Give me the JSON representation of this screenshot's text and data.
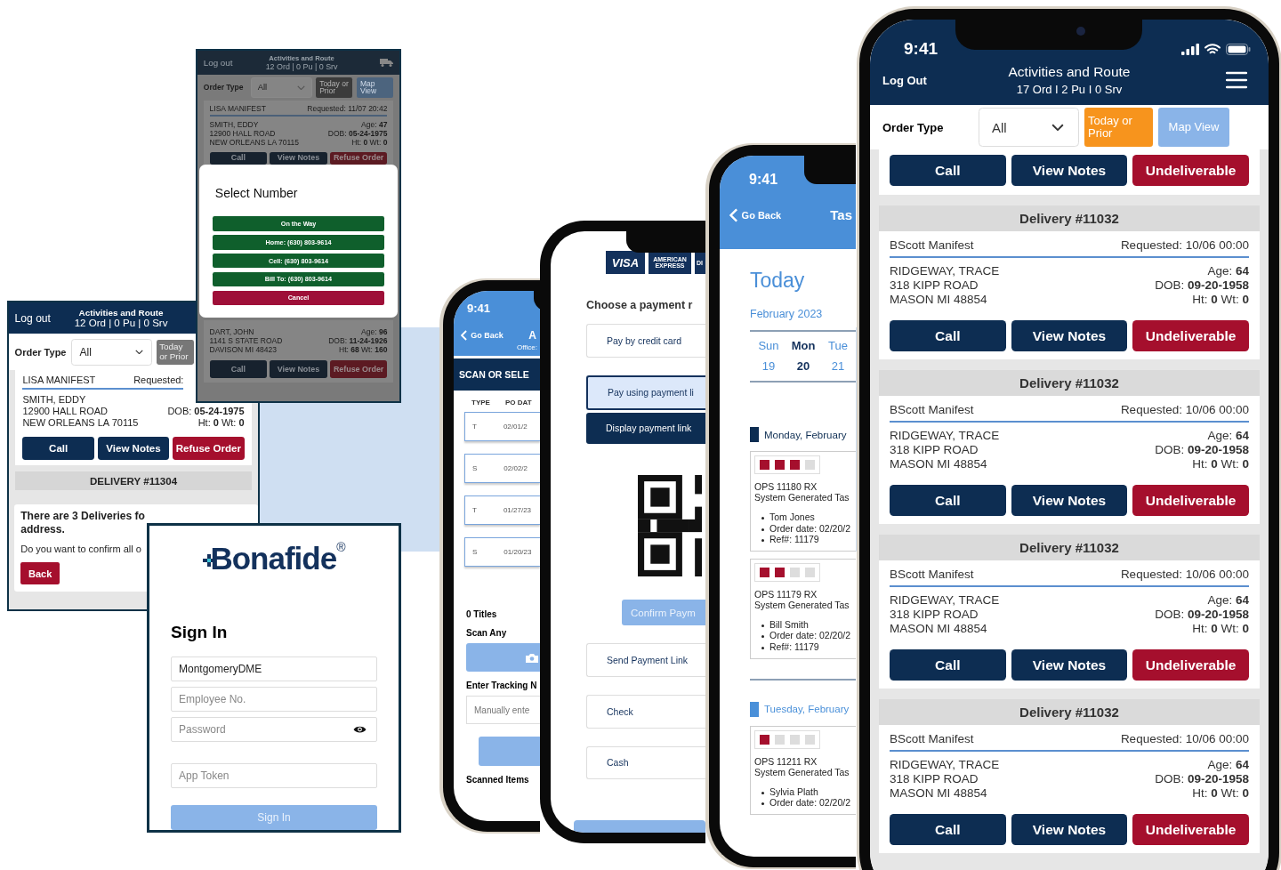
{
  "manifest_screen": {
    "logout": "Log out",
    "title": "Activities and Route",
    "counts": "12 Ord | 0 Pu | 0 Srv",
    "order_type_label": "Order Type",
    "order_type_value": "All",
    "filters": [
      {
        "label": "Today or Prior",
        "selected": false,
        "disabled": false
      },
      {
        "label": "Map View",
        "disabled": true
      }
    ],
    "items": [
      {
        "kind": "order",
        "manifest": "LISA MANIFEST",
        "requested": "Requested: 11/07 20:42",
        "name": "SMITH, EDDY",
        "address": "12900 HALL ROAD",
        "city": "NEW ORLEANS LA 70115",
        "age": "Age: **47**",
        "dob": "DOB: **05-24-1975**",
        "size": "Ht: **0** Wt: **0**",
        "buttons": [
          {
            "label": "Call",
            "kind": "call"
          },
          {
            "label": "View Notes",
            "kind": "notes"
          },
          {
            "label": "Refuse Order",
            "kind": "reject"
          }
        ]
      },
      {
        "kind": "select_dialog",
        "title": "Select Number",
        "options": [
          {
            "label": "On the Way",
            "kind": "option"
          },
          {
            "label": "Home: (630) 803-9614",
            "kind": "option"
          },
          {
            "label": "Cell: (630) 803-9614",
            "kind": "option"
          },
          {
            "label": "Bill To: (630) 803-9614",
            "kind": "option"
          },
          {
            "label": "Cancel",
            "kind": "cancel"
          }
        ]
      },
      {
        "kind": "order",
        "name": "DART, JOHN",
        "address": "1141 S STATE ROAD",
        "city": "DAVISON MI 48423",
        "age": "Age: **96**",
        "dob": "DOB: **11-24-1926**",
        "size": "Ht: **68** Wt: **160**",
        "buttons": [
          {
            "label": "Call",
            "kind": "call"
          },
          {
            "label": "View Notes",
            "kind": "notes"
          },
          {
            "label": "Refuse Order",
            "kind": "reject"
          }
        ]
      }
    ]
  },
  "confirm_screen": {
    "logout": "Log out",
    "title": "Activities and Route",
    "counts": "12 Ord | 0 Pu | 0 Srv",
    "order_type_label": "Order Type",
    "order_type_value": "All",
    "filters": [
      {
        "label": "Today or Prior",
        "selected": false,
        "disabled": false
      }
    ],
    "items": [
      {
        "kind": "order",
        "manifest": "LISA MANIFEST",
        "requested": "Requested:",
        "name": "SMITH, EDDY",
        "address": "12900 HALL ROAD",
        "city": "NEW ORLEANS LA 70115",
        "dob": "DOB: **05-24-1975**",
        "size": "Ht: **0** Wt: **0**",
        "buttons": [
          {
            "label": "Call",
            "kind": "call"
          },
          {
            "label": "View Notes",
            "kind": "notes"
          },
          {
            "label": "Refuse Order",
            "kind": "reject"
          }
        ]
      },
      {
        "kind": "header",
        "label": "DELIVERY #11304"
      },
      {
        "kind": "confirm_dialog",
        "title": "There are 3 Deliveries fo\naddress.",
        "message": "Do you want to confirm all o",
        "button": "Back"
      }
    ]
  },
  "sign_in": {
    "logo": "Bonafide$^{®}$",
    "heading": "Sign In",
    "fields": [
      {
        "kind": "text",
        "value": "MontgomeryDME"
      },
      {
        "kind": "text",
        "placeholder": "Employee No."
      },
      {
        "kind": "password",
        "placeholder": "Password"
      },
      {
        "kind": "text",
        "placeholder": "App Token"
      }
    ],
    "button": {
      "label": "Sign In",
      "disabled": true
    }
  },
  "scan_phone": {
    "time": "9:41",
    "back": "Go Back",
    "title": "A",
    "office": "Office:",
    "banner": "SCAN OR SELE",
    "columns": [
      "TYPE",
      "PO DAT"
    ],
    "rows": [
      {
        "type": "T",
        "po_date": "02/01/2"
      },
      {
        "type": "S",
        "po_date": "02/02/2"
      },
      {
        "type": "T",
        "po_date": "01/27/23"
      },
      {
        "type": "S",
        "po_date": "01/20/23"
      }
    ],
    "titles_count": "0 Titles",
    "scan_label": "Scan Any",
    "tracking_label": "Enter Tracking N",
    "tracking_placeholder": "Manually ente",
    "scanned_label": "Scanned Items"
  },
  "payment_phone": {
    "card_logos": [
      "VISA",
      "AMERICAN EXPRESS",
      "DI"
    ],
    "heading": "Choose a payment r",
    "options": [
      {
        "kind": "option",
        "label": "Pay by credit card",
        "selected": false
      },
      {
        "kind": "option",
        "label": "Pay using payment li",
        "selected": true
      },
      {
        "kind": "action",
        "label": "Display payment link"
      },
      {
        "kind": "qr"
      },
      {
        "kind": "confirm",
        "label": "Confirm Paym",
        "disabled": true
      },
      {
        "kind": "option",
        "label": "Send Payment Link",
        "selected": false
      },
      {
        "kind": "option",
        "label": "Check",
        "selected": false
      },
      {
        "kind": "option",
        "label": "Cash",
        "selected": false
      }
    ]
  },
  "tasks_phone": {
    "time": "9:41",
    "back": "Go Back",
    "title": "Tas",
    "heading": "Today",
    "month": "February 2023",
    "days": [
      {
        "name": "Sun",
        "date": "19",
        "selected": false
      },
      {
        "name": "Mon",
        "date": "20",
        "selected": true
      },
      {
        "name": "Tue",
        "date": "21",
        "selected": false
      }
    ],
    "groups": [
      {
        "label": "Monday, February",
        "color": "#0d2d52",
        "tasks": [
          {
            "stars": 3,
            "code": "OPS 11180 RX",
            "subtitle": "System Generated Tas",
            "details": [
              "Tom Jones",
              "Order date: 02/20/2",
              "Ref#: 11179"
            ]
          },
          {
            "stars": 2,
            "code": "OPS 11179 RX",
            "subtitle": "System Generated Tas",
            "details": [
              "Bill Smith",
              "Order date: 02/20/2",
              "Ref#: 11179"
            ]
          }
        ]
      },
      {
        "label": "Tuesday, February",
        "color": "#4a90d9",
        "tasks": [
          {
            "stars": 1,
            "code": "OPS 11211 RX",
            "subtitle": "System Generated Tas",
            "details": [
              "Sylvia Plath",
              "Order date: 02/20/2"
            ]
          }
        ]
      }
    ]
  },
  "route_phone": {
    "time": "9:41",
    "logout": "Log Out",
    "title": "Activities and Route",
    "counts": "17 Ord I 2 Pu I 0 Srv",
    "order_type_label": "Order Type",
    "order_type_value": "All",
    "filters": [
      {
        "label": "Today or Prior",
        "selected": true,
        "disabled": false
      },
      {
        "label": "Map View",
        "disabled": true
      }
    ],
    "items": [
      {
        "kind": "actions",
        "buttons": [
          {
            "label": "Call",
            "kind": "call"
          },
          {
            "label": "View Notes",
            "kind": "notes"
          },
          {
            "label": "Undeliverable",
            "kind": "reject"
          }
        ]
      },
      {
        "kind": "header",
        "label": "Delivery #11032"
      },
      {
        "kind": "order",
        "manifest": "BScott Manifest",
        "requested": "Requested: 10/06  00:00",
        "name": "RIDGEWAY, TRACE",
        "address": "318 KIPP ROAD",
        "city": "MASON MI 48854",
        "age": "Age: **64**",
        "dob": "DOB: **09-20-1958**",
        "size": "Ht: **0**  Wt: **0**",
        "buttons": [
          {
            "label": "Call",
            "kind": "call"
          },
          {
            "label": "View Notes",
            "kind": "notes"
          },
          {
            "label": "Undeliverable",
            "kind": "reject"
          }
        ]
      },
      {
        "kind": "header",
        "label": "Delivery #11032"
      },
      {
        "kind": "order",
        "manifest": "BScott Manifest",
        "requested": "Requested: 10/06  00:00",
        "name": "RIDGEWAY, TRACE",
        "address": "318 KIPP ROAD",
        "city": "MASON MI 48854",
        "age": "Age: **64**",
        "dob": "DOB: **09-20-1958**",
        "size": "Ht: **0**  Wt: **0**",
        "buttons": [
          {
            "label": "Call",
            "kind": "call"
          },
          {
            "label": "View Notes",
            "kind": "notes"
          },
          {
            "label": "Undeliverable",
            "kind": "reject"
          }
        ]
      },
      {
        "kind": "header",
        "label": "Delivery #11032"
      },
      {
        "kind": "order",
        "manifest": "BScott Manifest",
        "requested": "Requested: 10/06  00:00",
        "name": "RIDGEWAY, TRACE",
        "address": "318 KIPP ROAD",
        "city": "MASON MI 48854",
        "age": "Age: **64**",
        "dob": "DOB: **09-20-1958**",
        "size": "Ht: **0**  Wt: **0**",
        "buttons": [
          {
            "label": "Call",
            "kind": "call"
          },
          {
            "label": "View Notes",
            "kind": "notes"
          },
          {
            "label": "Undeliverable",
            "kind": "reject"
          }
        ]
      },
      {
        "kind": "header",
        "label": "Delivery #11032"
      },
      {
        "kind": "order",
        "manifest": "BScott Manifest",
        "requested": "Requested: 10/06  00:00",
        "name": "RIDGEWAY, TRACE",
        "address": "318 KIPP ROAD",
        "city": "MASON MI 48854",
        "age": "Age: **64**",
        "dob": "DOB: **09-20-1958**",
        "size": "Ht: **0**  Wt: **0**",
        "buttons": [
          {
            "label": "Call",
            "kind": "call"
          },
          {
            "label": "View Notes",
            "kind": "notes"
          },
          {
            "label": "Undeliverable",
            "kind": "reject"
          }
        ]
      }
    ]
  }
}
